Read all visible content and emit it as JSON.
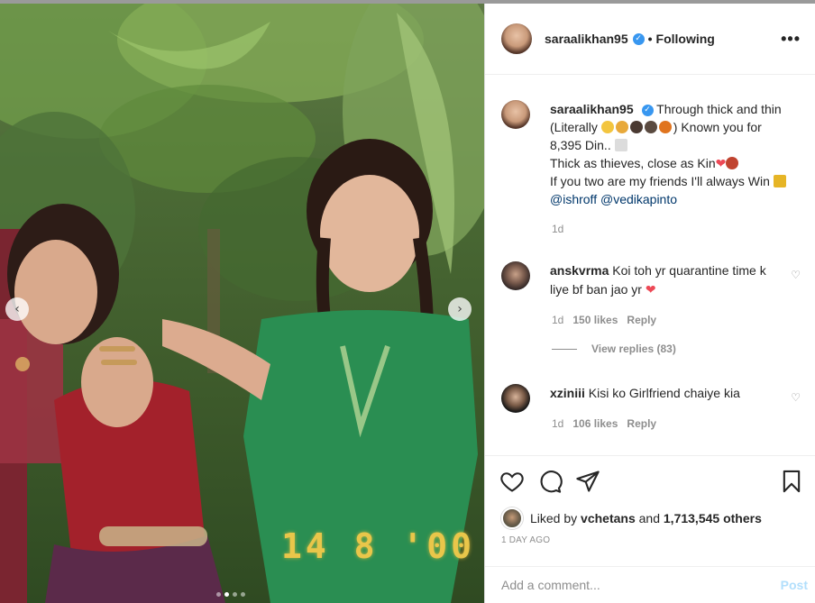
{
  "post": {
    "username": "saraalikhan95",
    "follow_status": "Following",
    "photo_date_stamp": "14 8 '00",
    "carousel_dots": 4,
    "carousel_active": 1
  },
  "caption": {
    "username": "saraalikhan95",
    "line1": "Through thick and thin (Literally",
    "line1_tail": ") Known you for 8,395 Din..",
    "line2": "Thick as thieves, close as Kin",
    "line3": "If you two are my friends I'll always Win",
    "mention1": "@ishroff",
    "mention2": "@vedikapinto",
    "time": "1d"
  },
  "comments": [
    {
      "username": "anskvrma",
      "text": "Koi toh yr quarantine time k liye bf ban jao yr",
      "time": "1d",
      "likes": "150 likes",
      "reply": "Reply",
      "view_replies": "View replies (83)"
    },
    {
      "username": "xziniii",
      "text": "Kisi ko Girlfriend chaiye kia",
      "time": "1d",
      "likes": "106 likes",
      "reply": "Reply"
    }
  ],
  "likes_summary": {
    "prefix": "Liked by",
    "user": "vchetans",
    "middle": "and",
    "count": "1,713,545 others"
  },
  "timestamp": "1 DAY AGO",
  "add_comment": {
    "placeholder": "Add a comment...",
    "post_label": "Post"
  },
  "icons": {
    "more": "more-options-icon",
    "like": "heart-icon",
    "comment": "comment-icon",
    "share": "share-icon",
    "save": "bookmark-icon"
  },
  "colors": {
    "accent": "#3897f0",
    "mention": "#00376b",
    "heart": "#ed4956",
    "muted": "#8e8e8e",
    "post_disabled": "#b2dffc"
  }
}
